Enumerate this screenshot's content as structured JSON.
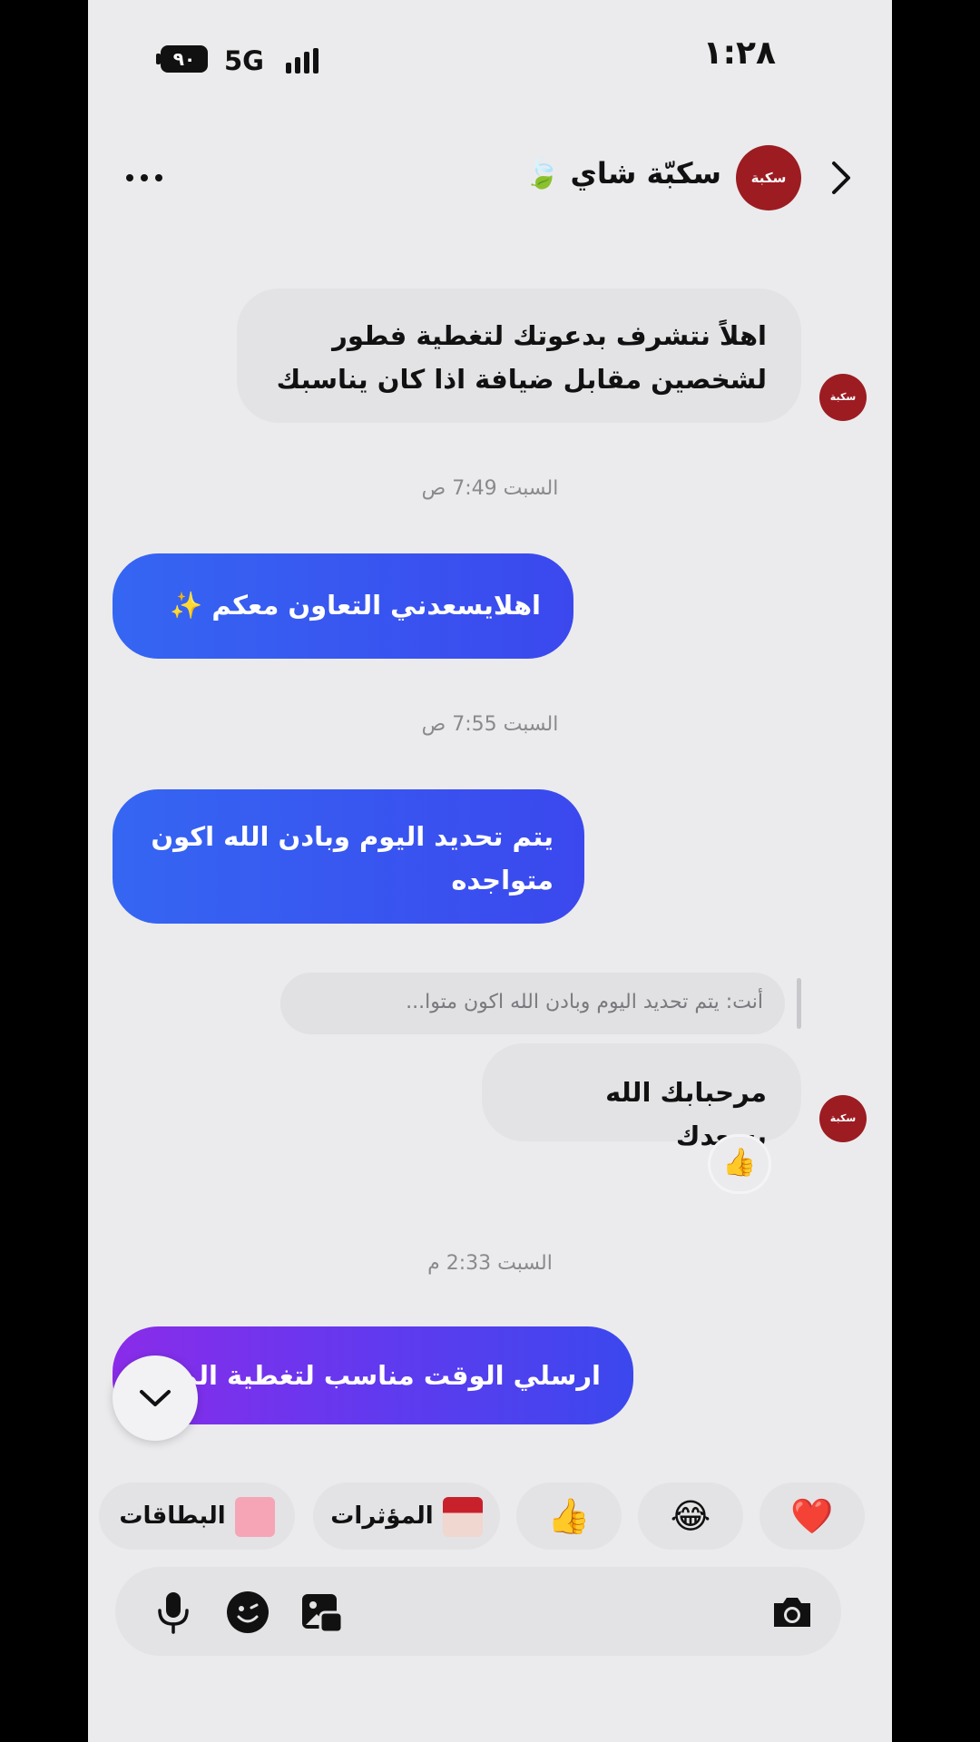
{
  "status_bar": {
    "time": "١:٢٨",
    "network": "5G",
    "battery": "٩٠"
  },
  "header": {
    "contact_name": "سكبّة شاي 🍃",
    "avatar_text": "سكبة"
  },
  "messages": [
    {
      "from": "them",
      "text": "اهلاً نتشرف بدعوتك لتغطية فطور لشخصين مقابل ضيافة اذا كان يناسبك"
    },
    {
      "type": "timestamp",
      "text": "السبت 7:49 ص"
    },
    {
      "from": "me",
      "text": "اهلايسعدني التعاون معكم ✨"
    },
    {
      "type": "timestamp",
      "text": "السبت 7:55 ص"
    },
    {
      "from": "me",
      "text": "يتم تحديد اليوم وبادن الله اكون متواجده"
    },
    {
      "type": "reply_quote",
      "text": "أنت: يتم تحديد اليوم وبادن الله اكون متوا..."
    },
    {
      "from": "them",
      "text": "مرحبابك الله يسعدك",
      "reaction": "👍"
    },
    {
      "type": "timestamp",
      "text": "السبت 2:33 م"
    },
    {
      "from": "me",
      "text": "ارسلي  الوقت مناسب لتغطية المكان"
    }
  ],
  "quick_replies": {
    "heart": "❤️",
    "laugh": "😂",
    "thumb": "👍",
    "influencers": "المؤثرات",
    "cards": "البطاقات"
  },
  "icons": {
    "back": "chevron-right-icon",
    "more": "more-horizontal-icon",
    "scroll_down": "chevron-down-icon",
    "mic": "microphone-icon",
    "sticker": "sticker-icon",
    "gallery": "gallery-icon",
    "camera": "camera-icon"
  },
  "colors": {
    "outgoing_bubble": "#3b57f0",
    "outgoing_bubble_gradient_start": "#8a2ce9",
    "incoming_bubble": "#e3e3e6",
    "background": "#ebebed",
    "brand_avatar": "#9c1c22"
  }
}
